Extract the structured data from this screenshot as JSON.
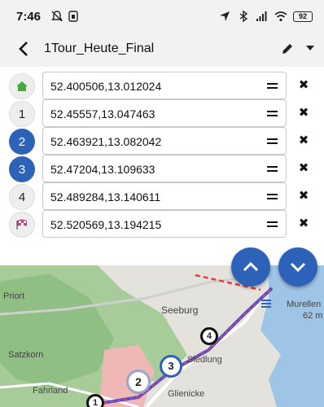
{
  "statusbar": {
    "time": "7:46",
    "battery": "92",
    "icons": [
      "mute-icon",
      "sim-icon",
      "location-arrow-icon",
      "bluetooth-icon",
      "signal-icon",
      "wifi-icon",
      "battery-icon"
    ]
  },
  "appbar": {
    "title": "1Tour_Heute_Final",
    "icons": [
      "back-arrow-icon",
      "pencil-icon",
      "dropdown-caret-icon"
    ]
  },
  "waypoints": [
    {
      "marker": "",
      "marker_icon": "home-icon",
      "value": "52.400506,13.012024"
    },
    {
      "marker": "1",
      "value": "52.45557,13.047463"
    },
    {
      "marker": "2",
      "value": "52.463921,13.082042"
    },
    {
      "marker": "3",
      "value": "52.47204,13.109633"
    },
    {
      "marker": "4",
      "value": "52.489284,13.140611"
    },
    {
      "marker": "",
      "marker_icon": "checkered-flag-icon",
      "value": "52.520569,13.194215"
    }
  ],
  "map": {
    "labels": {
      "priort": "Priort",
      "seeburg": "Seeburg",
      "murellen": "Murellen",
      "elevation": "62 m",
      "satzkorn": "Satzkorn",
      "siedlung": "Siedlung",
      "fahrland": "Fahrland",
      "glienicke": "Glienicke"
    },
    "markers": [
      "1",
      "2",
      "3",
      "4"
    ],
    "colors": {
      "route": "#5a4fc8",
      "route_dash": "#e04040",
      "forest": "#8fc28a",
      "water": "#9ec4e6",
      "urban": "#f0b7b7"
    }
  },
  "fabs": {
    "up": "chevron-up-icon",
    "down": "chevron-down-icon"
  }
}
